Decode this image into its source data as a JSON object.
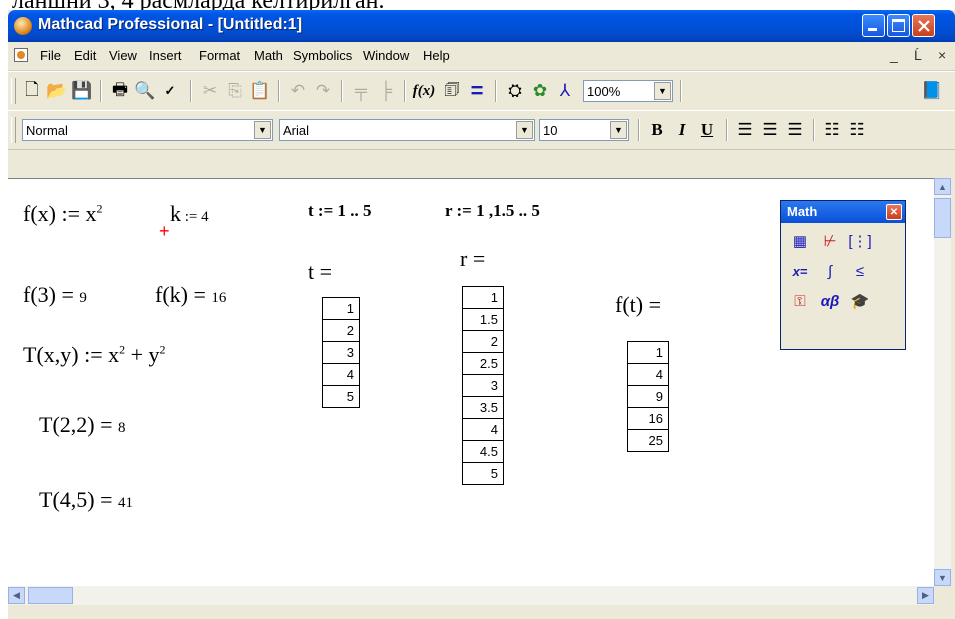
{
  "caption_top": "ланшни 3, 4 расмларда келтирилган.",
  "window": {
    "title": "Mathcad Professional - [Untitled:1]",
    "controls": [
      "minimize-icon",
      "maximize-icon",
      "close-icon"
    ]
  },
  "menu": {
    "items": [
      "File",
      "Edit",
      "View",
      "Insert",
      "Format",
      "Math",
      "Symbolics",
      "Window",
      "Help"
    ],
    "doc_controls": [
      "_",
      "Ĺ",
      "×"
    ]
  },
  "toolbar": {
    "zoom": "100%"
  },
  "format_toolbar": {
    "style": "Normal",
    "font": "Arial",
    "size": "10",
    "bold": "B",
    "italic": "I",
    "underline": "U"
  },
  "worksheet": {
    "f_def": "f(x) := x",
    "f_def_exp": "2",
    "k_def": "k",
    "k_assign": " := 4",
    "t_def": "t := 1 .. 5",
    "r_def": "r := 1 ,1.5 .. 5",
    "f3_expr": "f(3) =",
    "f3_val": "9",
    "fk_expr": "f(k) =",
    "fk_val": "16",
    "T_def": "T(x,y) := x",
    "T_def_exp1": "2",
    "T_def_mid": " + y",
    "T_def_exp2": "2",
    "T22_expr": "T(2,2) =",
    "T22_val": "8",
    "T45_expr": "T(4,5) =",
    "T45_val": "41",
    "t_eq": "t =",
    "r_eq": "r =",
    "ft_eq": "f(t) =",
    "t_values": [
      "1",
      "2",
      "3",
      "4",
      "5"
    ],
    "r_values": [
      "1",
      "1.5",
      "2",
      "2.5",
      "3",
      "3.5",
      "4",
      "4.5",
      "5"
    ],
    "ft_values": [
      "1",
      "4",
      "9",
      "16",
      "25"
    ]
  },
  "palette": {
    "title": "Math",
    "buttons": [
      "calculator-icon",
      "graph-icon",
      "matrix-icon",
      "evaluation-icon",
      "calculus-icon",
      "boolean-icon",
      "programming-icon",
      "greek-icon",
      "symbolic-icon"
    ]
  }
}
